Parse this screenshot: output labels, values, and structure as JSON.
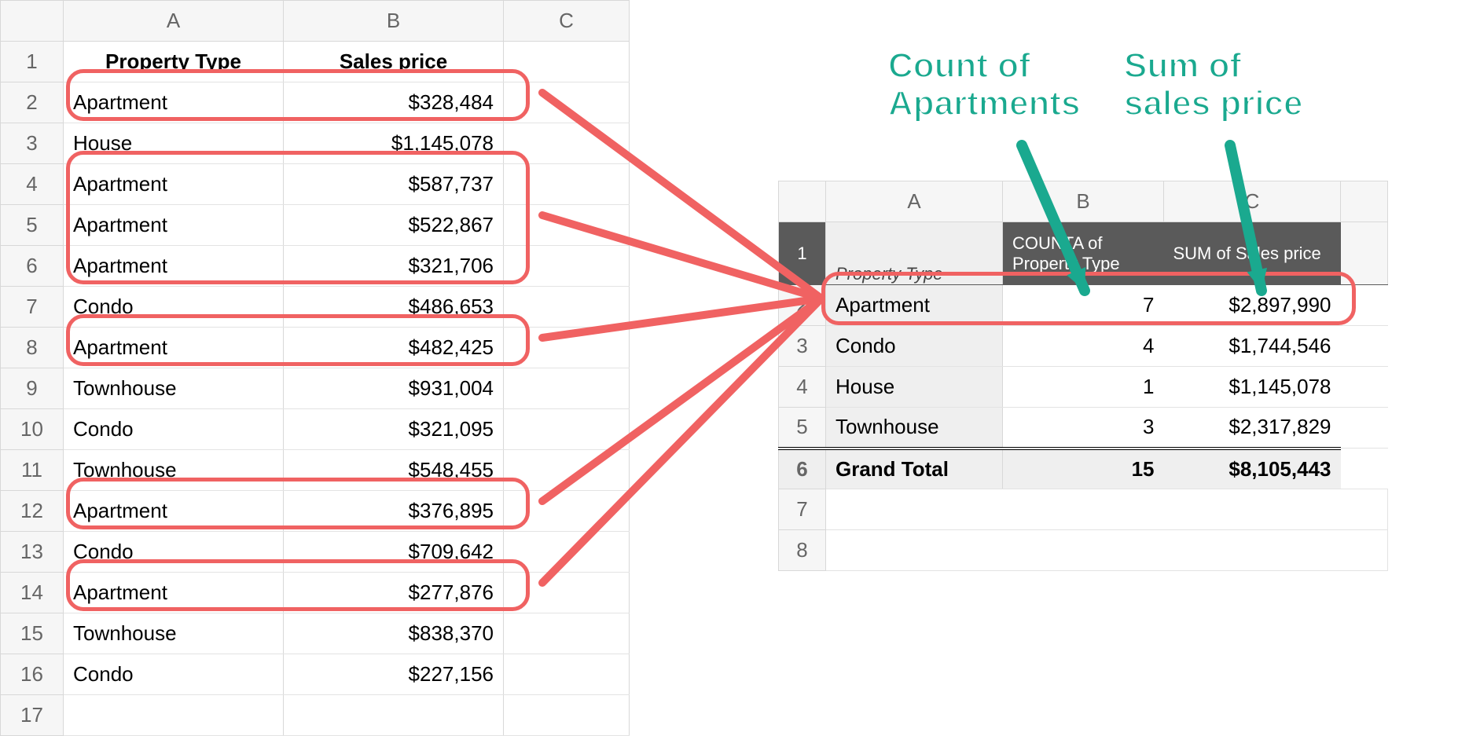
{
  "source_table": {
    "column_letters": [
      "A",
      "B",
      "C"
    ],
    "headers": {
      "A": "Property Type",
      "B": "Sales price"
    },
    "rows": [
      {
        "A": "Apartment",
        "B": "$328,484",
        "hl": true
      },
      {
        "A": "House",
        "B": "$1,145,078",
        "hl": false
      },
      {
        "A": "Apartment",
        "B": "$587,737",
        "hl": true
      },
      {
        "A": "Apartment",
        "B": "$522,867",
        "hl": true
      },
      {
        "A": "Apartment",
        "B": "$321,706",
        "hl": true
      },
      {
        "A": "Condo",
        "B": "$486,653",
        "hl": false
      },
      {
        "A": "Apartment",
        "B": "$482,425",
        "hl": true
      },
      {
        "A": "Townhouse",
        "B": "$931,004",
        "hl": false
      },
      {
        "A": "Condo",
        "B": "$321,095",
        "hl": false
      },
      {
        "A": "Townhouse",
        "B": "$548,455",
        "hl": false
      },
      {
        "A": "Apartment",
        "B": "$376,895",
        "hl": true
      },
      {
        "A": "Condo",
        "B": "$709,642",
        "hl": false
      },
      {
        "A": "Apartment",
        "B": "$277,876",
        "hl": true
      },
      {
        "A": "Townhouse",
        "B": "$838,370",
        "hl": false
      },
      {
        "A": "Condo",
        "B": "$227,156",
        "hl": false
      }
    ]
  },
  "pivot_table": {
    "column_letters": [
      "A",
      "B",
      "C"
    ],
    "row_field_label": "Property Type",
    "value_headers": {
      "B": "COUNTA of Property Type",
      "C": "SUM of Sales price"
    },
    "rows": [
      {
        "label": "Apartment",
        "B": "7",
        "C": "$2,897,990",
        "hl": true
      },
      {
        "label": "Condo",
        "B": "4",
        "C": "$1,744,546",
        "hl": false
      },
      {
        "label": "House",
        "B": "1",
        "C": "$1,145,078",
        "hl": false
      },
      {
        "label": "Townhouse",
        "B": "3",
        "C": "$2,317,829",
        "hl": false
      }
    ],
    "grand_total": {
      "label": "Grand Total",
      "B": "15",
      "C": "$8,105,443"
    },
    "trailing_row_numbers": [
      "7",
      "8"
    ]
  },
  "annotations": {
    "count": "Count of Apartments",
    "sum": "Sum of sales price"
  },
  "colors": {
    "highlight": "#f06262",
    "arrow": "#1aa98f"
  }
}
